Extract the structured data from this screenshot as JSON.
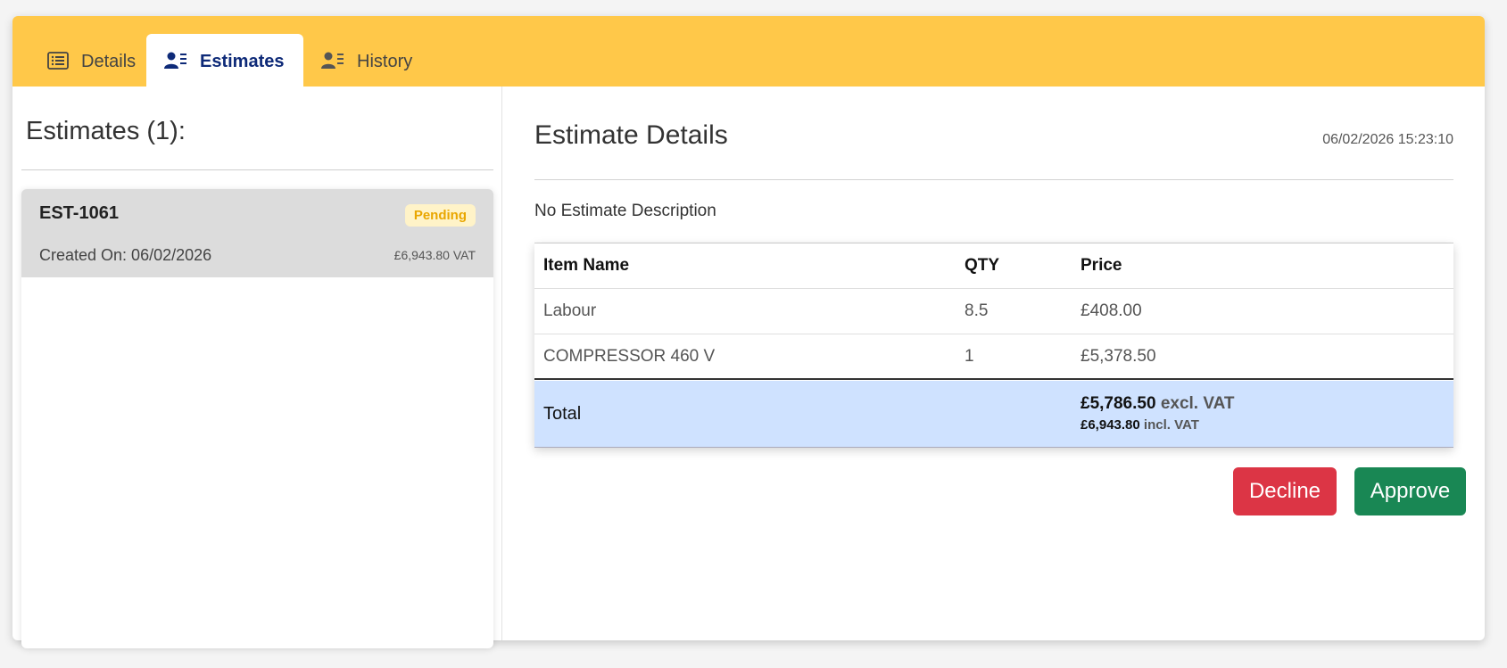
{
  "tabs": [
    {
      "label": "Details",
      "icon": "list-icon",
      "active": false
    },
    {
      "label": "Estimates",
      "icon": "user-list-icon",
      "active": true
    },
    {
      "label": "History",
      "icon": "user-list-icon",
      "active": false
    }
  ],
  "estimates_panel": {
    "title": "Estimates (1):",
    "items": [
      {
        "code": "EST-1061",
        "status": "Pending",
        "created": "Created On: 06/02/2026",
        "amount": "£6,943.80 VAT"
      }
    ]
  },
  "details": {
    "title": "Estimate Details",
    "datetime": "06/02/2026 15:23:10",
    "description": "No Estimate Description",
    "table": {
      "headers": [
        "Item Name",
        "QTY",
        "Price"
      ],
      "rows": [
        [
          "Labour",
          "8.5",
          "£408.00"
        ],
        [
          "COMPRESSOR 460 V",
          "1",
          "£5,378.50"
        ]
      ],
      "total_label": "Total",
      "total_excl_value": "£5,786.50",
      "total_excl_label": "excl. VAT",
      "total_incl_value": "£6,943.80",
      "total_incl_label": "incl. VAT"
    },
    "buttons": {
      "decline": "Decline",
      "approve": "Approve"
    }
  },
  "colors": {
    "tabbar": "#ffc849",
    "active_tab_text": "#0e2a78",
    "pending_badge": "#e9a600",
    "total_row_bg": "#cfe2ff",
    "decline": "#dc3545",
    "approve": "#198754"
  }
}
